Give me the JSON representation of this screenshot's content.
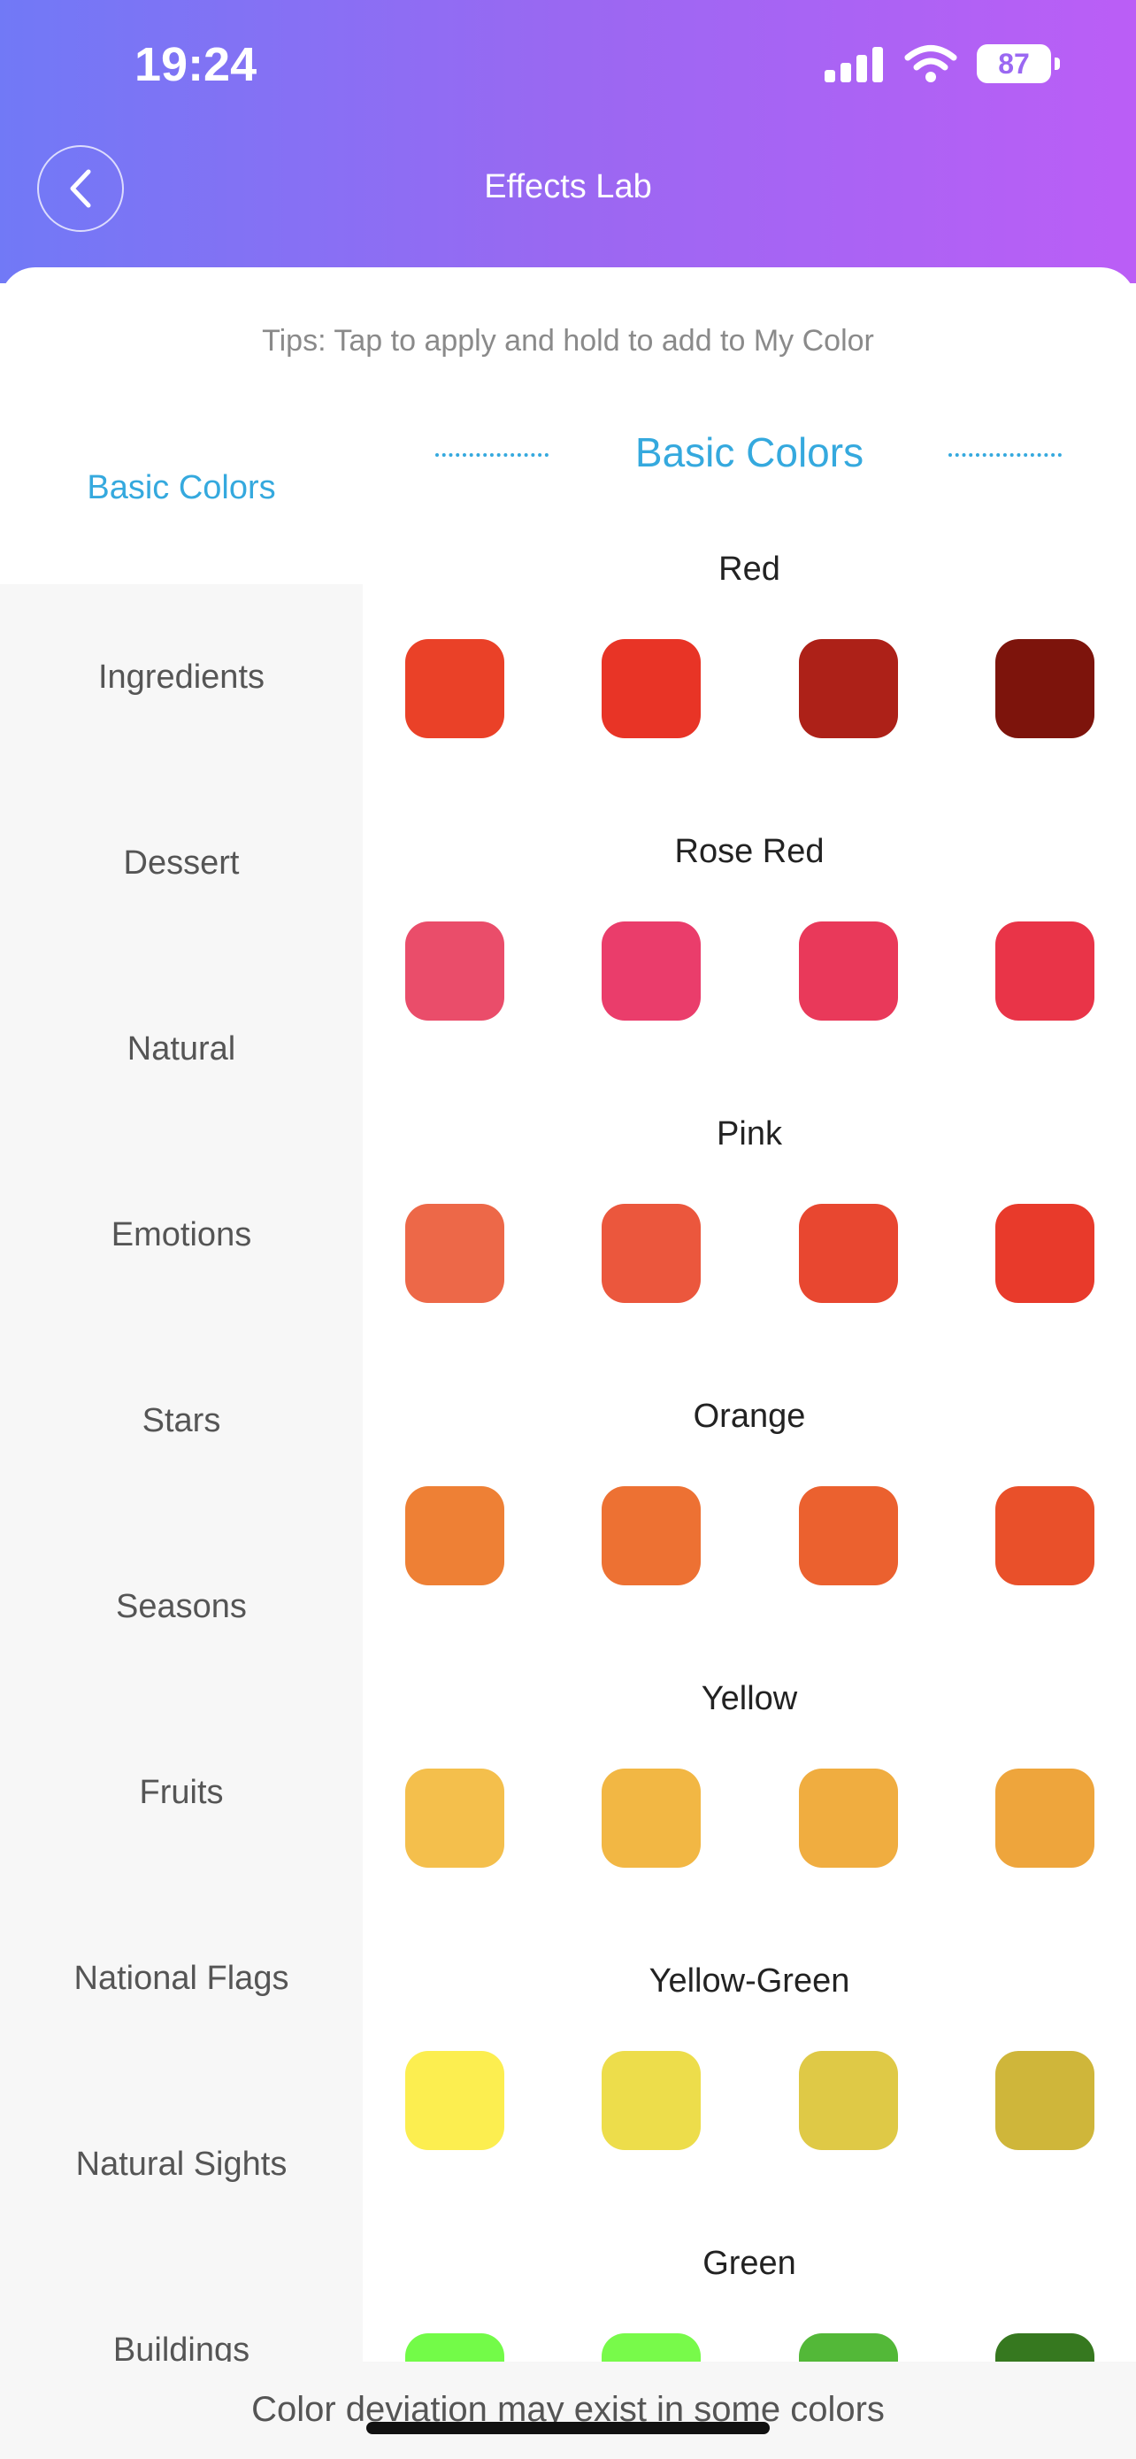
{
  "status": {
    "time": "19:24",
    "battery": "87"
  },
  "header": {
    "title": "Effects Lab"
  },
  "tips": "Tips: Tap to apply and hold to add to My Color",
  "sidebar": {
    "active": "Basic Colors",
    "items": [
      "Ingredients",
      "Dessert",
      "Natural",
      "Emotions",
      "Stars",
      "Seasons",
      "Fruits",
      "National Flags",
      "Natural Sights",
      "Buildings"
    ]
  },
  "section": {
    "title": "Basic Colors"
  },
  "groups": [
    {
      "name": "Red",
      "colors": [
        "#ea4128",
        "#e83426",
        "#ad2118",
        "#7d140c"
      ]
    },
    {
      "name": "Rose Red",
      "colors": [
        "#ea4d6a",
        "#ea3d6b",
        "#e9395a",
        "#e93448"
      ]
    },
    {
      "name": "Pink",
      "colors": [
        "#ed6848",
        "#eb573d",
        "#e84730",
        "#e83a2b"
      ]
    },
    {
      "name": "Orange",
      "colors": [
        "#ee8035",
        "#ed7133",
        "#eb612f",
        "#e9502a"
      ]
    },
    {
      "name": "Yellow",
      "colors": [
        "#f4bf4c",
        "#f2b744",
        "#f0ad40",
        "#eea53c"
      ]
    },
    {
      "name": "Yellow-Green",
      "colors": [
        "#fcee50",
        "#eddd4b",
        "#dfc946",
        "#cfb63a"
      ]
    },
    {
      "name": "Green",
      "colors": [
        "#73fb48",
        "#78fa4a",
        "#53b838",
        "#36781f"
      ]
    }
  ],
  "footer": {
    "note": "Color deviation may exist in some colors"
  }
}
